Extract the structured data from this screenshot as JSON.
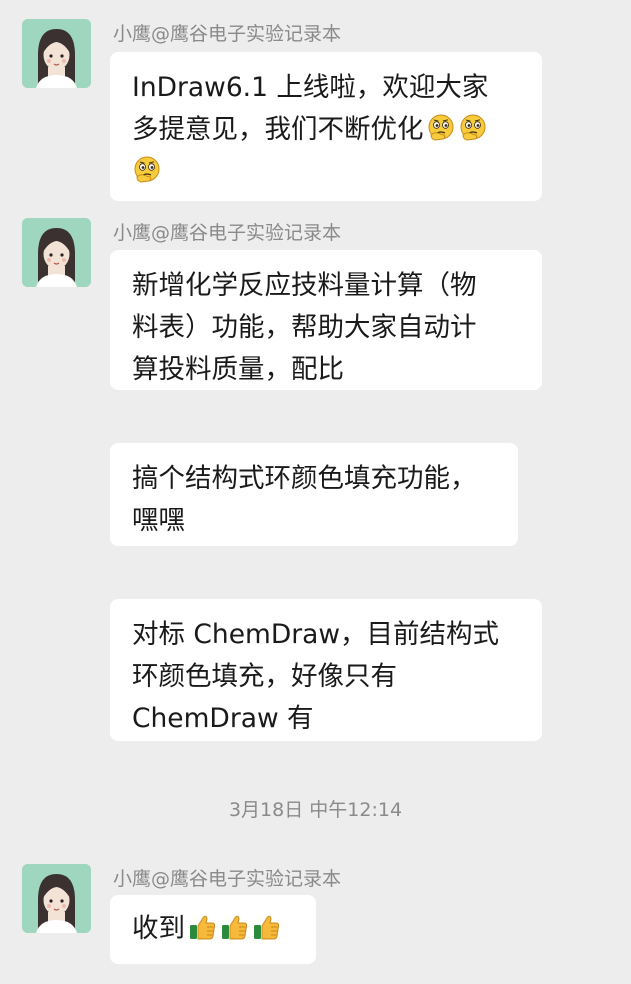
{
  "messages": [
    {
      "sender": "小鹰@鹰谷电子实验记录本",
      "lines": [
        "InDraw6.1 上线啦，欢迎大家",
        "多提意见，我们不断优化"
      ]
    },
    {
      "sender": "小鹰@鹰谷电子实验记录本",
      "lines": [
        "新增化学反应技料量计算（物",
        "料表）功能，帮助大家自动计",
        "算投料质量，配比"
      ]
    },
    {
      "lines": [
        "搞个结构式环颜色填充功能，",
        "嘿嘿"
      ]
    },
    {
      "lines": [
        "对标 ChemDraw，目前结构式",
        "环颜色填充，好像只有",
        "ChemDraw 有"
      ]
    },
    {
      "sender": "小鹰@鹰谷电子实验记录本",
      "lines": [
        "收到"
      ]
    }
  ],
  "timestamp": "3月18日 中午12:14",
  "icons": {
    "avatar": "girl-avatar-icon",
    "emoji_thinking": "thinking-face-emoji",
    "emoji_thumbs_up": "thumbs-up-emoji"
  },
  "colors": {
    "background": "#ededed",
    "bubble": "#ffffff",
    "avatar_bg": "#9fd6bf",
    "meta_text": "#8a8a8a"
  }
}
